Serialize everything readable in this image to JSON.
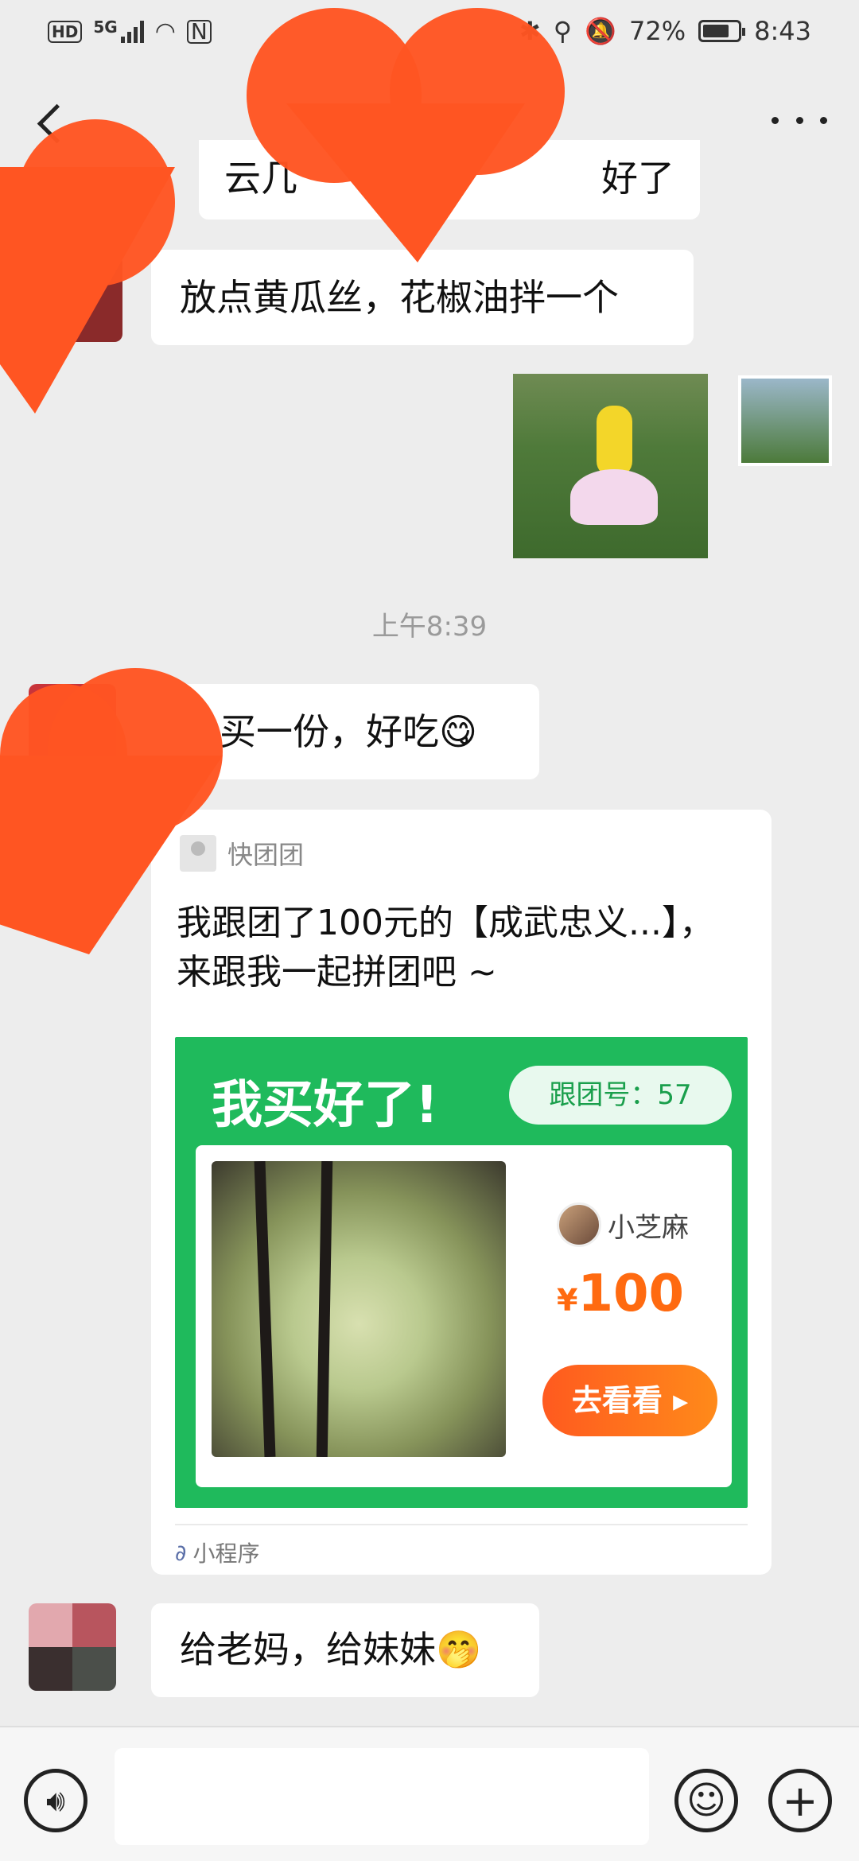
{
  "status_bar": {
    "hd": "HD",
    "network": "5G",
    "battery": "72%",
    "time": "8:43"
  },
  "messages": [
    {
      "text": "云几",
      "trailing": "好了"
    },
    {
      "text": "放点黄瓜丝，花椒油拌一个"
    },
    {
      "text": "买一份，好吃😋"
    },
    {
      "text": "给老妈，给妹妹🤭"
    }
  ],
  "timestamp": "上午8:39",
  "card": {
    "source": "快团团",
    "title": "我跟团了100元的【成武忠义...】，来跟我一起拼团吧 ~",
    "promo_headline": "我买好了!",
    "group_no": "跟团号：57",
    "seller": "小芝麻",
    "price": "100",
    "currency": "¥",
    "button": "去看看 ▸",
    "footer": "小程序"
  },
  "input": {
    "placeholder": ""
  }
}
